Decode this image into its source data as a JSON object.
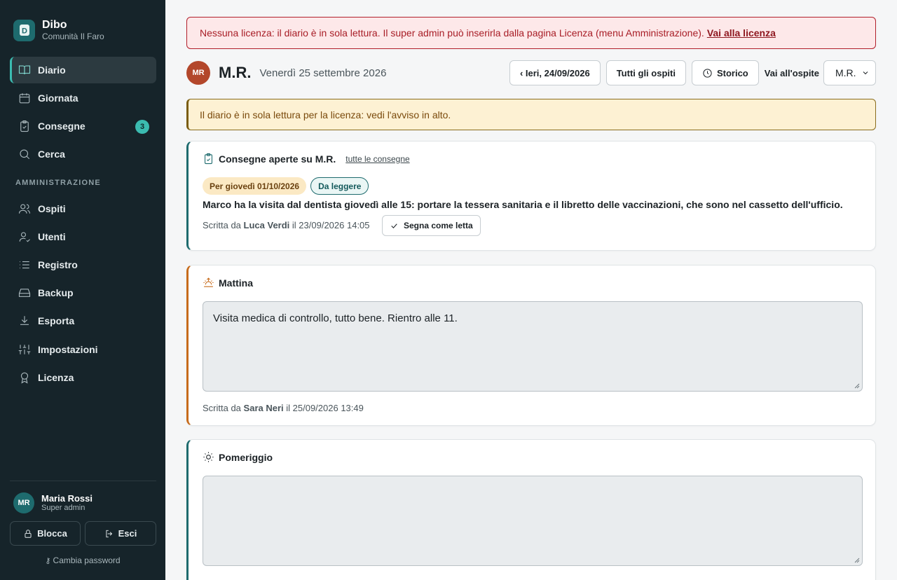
{
  "brand": {
    "name": "Dibo",
    "subtitle": "Comunità Il Faro",
    "logo_letter": "D"
  },
  "nav": {
    "items": [
      {
        "label": "Diario",
        "icon": "book-icon",
        "active": true
      },
      {
        "label": "Giornata",
        "icon": "calendar-icon"
      },
      {
        "label": "Consegne",
        "icon": "clipboard-icon",
        "badge": "3"
      },
      {
        "label": "Cerca",
        "icon": "search-icon"
      }
    ],
    "admin_label": "AMMINISTRAZIONE",
    "admin_items": [
      {
        "label": "Ospiti",
        "icon": "users-icon"
      },
      {
        "label": "Utenti",
        "icon": "user-check-icon"
      },
      {
        "label": "Registro",
        "icon": "list-icon"
      },
      {
        "label": "Backup",
        "icon": "drive-icon"
      },
      {
        "label": "Esporta",
        "icon": "download-icon"
      },
      {
        "label": "Impostazioni",
        "icon": "sliders-icon"
      },
      {
        "label": "Licenza",
        "icon": "award-icon"
      }
    ]
  },
  "user": {
    "initials": "MR",
    "name": "Maria Rossi",
    "role": "Super admin"
  },
  "sidebar_buttons": {
    "lock": "Blocca",
    "logout": "Esci",
    "change_password": "Cambia password"
  },
  "license_alert": {
    "text": "Nessuna licenza: il diario è in sola lettura. Il super admin può inserirla dalla pagina Licenza (menu Amministrazione).",
    "link": "Vai alla licenza"
  },
  "guest": {
    "initials": "MR",
    "name": "M.R.",
    "date": "Venerdì 25 settembre 2026"
  },
  "toolbar": {
    "prev_day": "‹ Ieri, 24/09/2026",
    "all_guests": "Tutti gli ospiti",
    "history": "Storico",
    "go_to_guest_label": "Vai all'ospite",
    "guest_select": "M.R."
  },
  "readonly_alert": "Il diario è in sola lettura per la licenza: vedi l'avviso in alto.",
  "handover": {
    "title": "Consegne aperte su M.R.",
    "all_link": "tutte le consegne",
    "due_chip": "Per giovedì 01/10/2026",
    "status_chip": "Da leggere",
    "text": "Marco ha la visita dal dentista giovedì alle 15: portare la tessera sanitaria e il libretto delle vaccinazioni, che sono nel cassetto dell'ufficio.",
    "meta_prefix": "Scritta da",
    "author": "Luca Verdi",
    "meta_suffix": "il 23/09/2026 14:05",
    "mark_read": "Segna come letta"
  },
  "morning": {
    "title": "Mattina",
    "text": "Visita medica di controllo, tutto bene. Rientro alle 11.",
    "meta_prefix": "Scritta da",
    "author": "Sara Neri",
    "meta_suffix": "il 25/09/2026 13:49"
  },
  "afternoon": {
    "title": "Pomeriggio",
    "text": ""
  },
  "colors": {
    "sidebar": "#16242a",
    "accent": "#3bbbb0",
    "teal": "#1e6b6e",
    "orange": "#c76b1b",
    "danger": "#b11e2a"
  }
}
